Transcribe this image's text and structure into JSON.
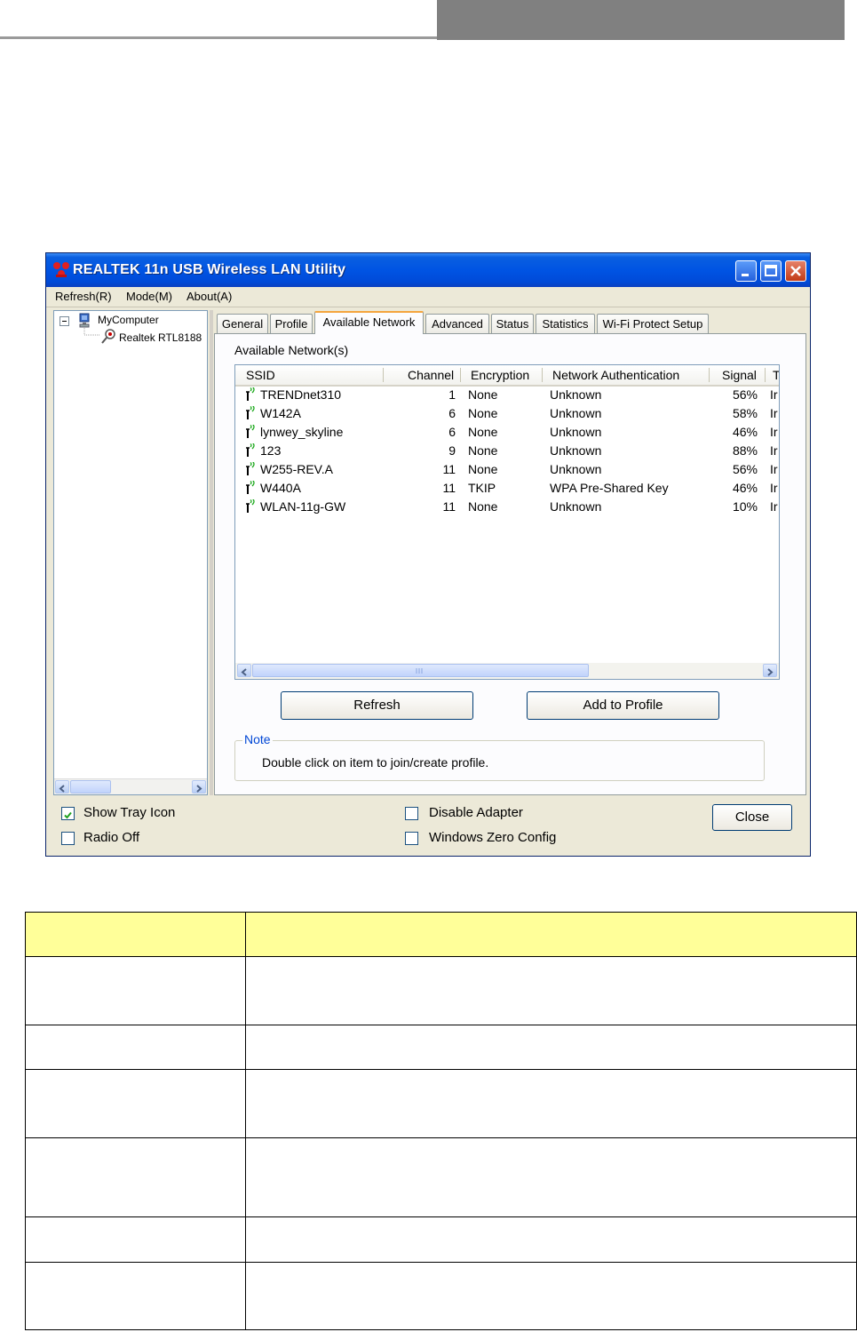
{
  "window": {
    "title": "REALTEK 11n USB Wireless LAN Utility",
    "buttons": [
      "minimize",
      "maximize",
      "close"
    ]
  },
  "menu": [
    "Refresh(R)",
    "Mode(M)",
    "About(A)"
  ],
  "tree": {
    "root": "MyComputer",
    "adapter": "Realtek RTL8188"
  },
  "tabs": [
    "General",
    "Profile",
    "Available Network",
    "Advanced",
    "Status",
    "Statistics",
    "Wi-Fi Protect Setup"
  ],
  "active_tab": "Available Network",
  "panel": {
    "title": "Available Network(s)",
    "columns": [
      "SSID",
      "Channel",
      "Encryption",
      "Network Authentication",
      "Signal",
      "T"
    ],
    "rows": [
      {
        "ssid": "TRENDnet310",
        "channel": "1",
        "encryption": "None",
        "auth": "Unknown",
        "signal": "56%",
        "type": "Ir"
      },
      {
        "ssid": "W142A",
        "channel": "6",
        "encryption": "None",
        "auth": "Unknown",
        "signal": "58%",
        "type": "Ir"
      },
      {
        "ssid": "lynwey_skyline",
        "channel": "6",
        "encryption": "None",
        "auth": "Unknown",
        "signal": "46%",
        "type": "Ir"
      },
      {
        "ssid": "123",
        "channel": "9",
        "encryption": "None",
        "auth": "Unknown",
        "signal": "88%",
        "type": "Ir"
      },
      {
        "ssid": "W255-REV.A",
        "channel": "11",
        "encryption": "None",
        "auth": "Unknown",
        "signal": "56%",
        "type": "Ir"
      },
      {
        "ssid": "W440A",
        "channel": "11",
        "encryption": "TKIP",
        "auth": "WPA Pre-Shared Key",
        "signal": "46%",
        "type": "Ir"
      },
      {
        "ssid": "WLAN-11g-GW",
        "channel": "11",
        "encryption": "None",
        "auth": "Unknown",
        "signal": "10%",
        "type": "Ir"
      }
    ],
    "refresh_label": "Refresh",
    "add_profile_label": "Add to Profile",
    "note_legend": "Note",
    "note_text": "Double click on item to join/create profile."
  },
  "footer": {
    "show_tray_icon": {
      "label": "Show Tray Icon",
      "checked": true
    },
    "radio_off": {
      "label": "Radio Off",
      "checked": false
    },
    "disable_adapter": {
      "label": "Disable Adapter",
      "checked": false
    },
    "windows_zero_config": {
      "label": "Windows Zero Config",
      "checked": false
    },
    "close_label": "Close"
  },
  "colors": {
    "titlebar": "#0054e3",
    "active_tab_accent": "#f4a53e",
    "note_legend": "#0046d5",
    "table_header": "#ffff99",
    "doc_header_bar": "#808080"
  }
}
